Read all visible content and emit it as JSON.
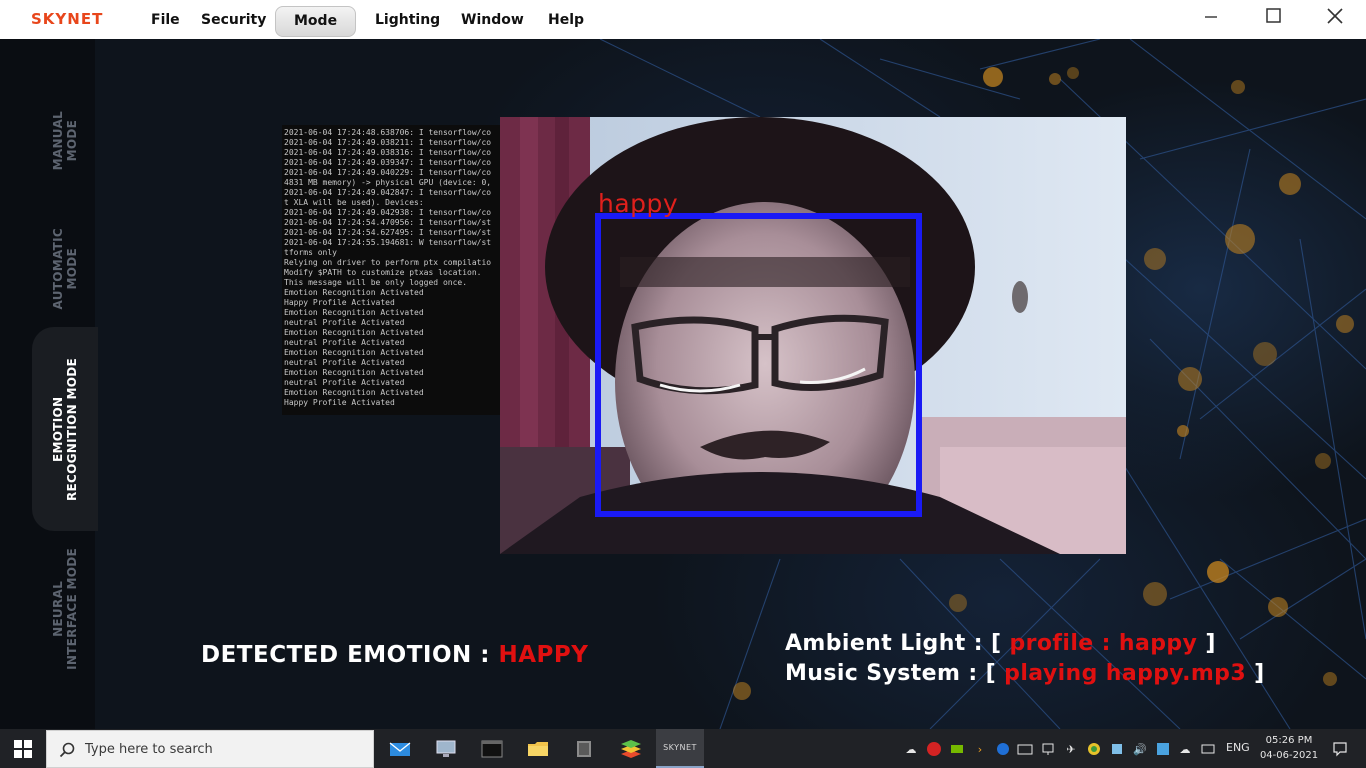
{
  "app": {
    "logo": "SKYNET"
  },
  "menu": [
    "File",
    "Security",
    "Mode",
    "Lighting",
    "Window",
    "Help"
  ],
  "window_controls": [
    "minimize",
    "maximize",
    "close"
  ],
  "modes": [
    {
      "label": "MANUAL\nMODE",
      "active": false
    },
    {
      "label": "AUTOMATIC\nMODE",
      "active": false
    },
    {
      "label": "EMOTION\nRECOGNITION MODE",
      "active": true
    },
    {
      "label": "NEURAL\nINTERFACE MODE",
      "active": false
    }
  ],
  "console_lines": [
    "2021-06-04 17:24:48.638706: I tensorflow/co",
    "2021-06-04 17:24:49.038211: I tensorflow/co",
    "2021-06-04 17:24:49.038316: I tensorflow/co",
    "2021-06-04 17:24:49.039347: I tensorflow/co",
    "2021-06-04 17:24:49.040229: I tensorflow/co",
    "4831 MB memory) -> physical GPU (device: 0,",
    "2021-06-04 17:24:49.042847: I tensorflow/co",
    "t XLA will be used). Devices:",
    "2021-06-04 17:24:49.042938: I tensorflow/co",
    "2021-06-04 17:24:54.470956: I tensorflow/st",
    "2021-06-04 17:24:54.627495: I tensorflow/st",
    "2021-06-04 17:24:55.194681: W tensorflow/st",
    "tforms only",
    "Relying on driver to perform ptx compilatio",
    "Modify $PATH to customize ptxas location.",
    "This message will be only logged once.",
    "Emotion Recognition Activated",
    "Happy Profile Activated",
    "Emotion Recognition Activated",
    "neutral Profile Activated",
    "Emotion Recognition Activated",
    "neutral Profile Activated",
    "Emotion Recognition Activated",
    "neutral Profile Activated",
    "Emotion Recognition Activated",
    "neutral Profile Activated",
    "Emotion Recognition Activated",
    "Happy Profile Activated"
  ],
  "camera": {
    "face_label": "happy",
    "box_color": "#1a1af5",
    "label_color": "#e0201c"
  },
  "detected": {
    "prefix": "DETECTED EMOTION : ",
    "value": "HAPPY"
  },
  "ambient": {
    "label": "Ambient Light : [ ",
    "value": "profile : happy",
    "suffix": " ]"
  },
  "music": {
    "label": "Music System : [ ",
    "value": "playing happy.mp3",
    "suffix": " ]"
  },
  "colors": {
    "accent_red": "#e01010",
    "logo": "#e8461b",
    "background": "#0e131b"
  },
  "taskbar": {
    "search_placeholder": "Type here to search",
    "running_app_label": "SKYNET",
    "language": "ENG",
    "time": "05:26 PM",
    "date": "04-06-2021"
  }
}
